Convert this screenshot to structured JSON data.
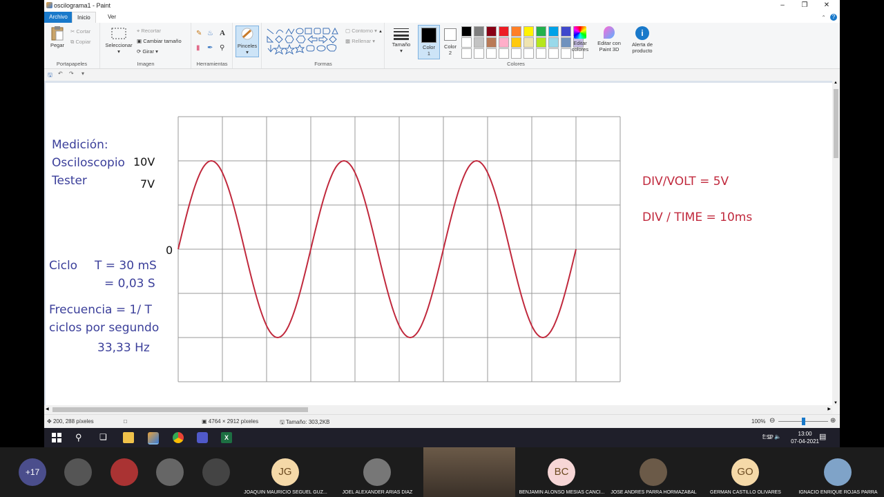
{
  "window": {
    "title": "oscilograma1 - Paint"
  },
  "tabs": {
    "file": "Archivo",
    "home": "Inicio",
    "view": "Ver"
  },
  "ribbon": {
    "clipboard": {
      "paste": "Pegar",
      "cut": "Cortar",
      "copy": "Copiar",
      "label": "Portapapeles"
    },
    "image": {
      "select": "Seleccionar",
      "crop": "Recortar",
      "resize": "Cambiar tamaño",
      "rotate": "Girar",
      "label": "Imagen"
    },
    "tools": {
      "label": "Herramientas"
    },
    "brushes": {
      "label": "Pinceles"
    },
    "shapes": {
      "outline": "Contorno",
      "fill": "Rellenar",
      "label": "Formas"
    },
    "size": {
      "label": "Tamaño"
    },
    "color1": "Color\n1",
    "color2": "Color\n2",
    "colors": {
      "label": "Colores",
      "edit": "Editar colores"
    },
    "paint3d": "Editar con Paint 3D",
    "alert": "Alerta de producto",
    "palette_row1": [
      "#000000",
      "#7f7f7f",
      "#880015",
      "#ed1c24",
      "#ff7f27",
      "#fff200",
      "#22b14c",
      "#00a2e8",
      "#3f48cc",
      "#a349a4"
    ],
    "palette_row2": [
      "#ffffff",
      "#c3c3c3",
      "#b97a57",
      "#ffaec9",
      "#ffc90e",
      "#efe4b0",
      "#b5e61d",
      "#99d9ea",
      "#7092be",
      "#c8bfe7"
    ]
  },
  "canvas": {
    "annotations": {
      "medicion": "Medición:",
      "osciloscopio": "Osciloscopio",
      "tester": "Tester",
      "v10": "10V",
      "v7": "7V",
      "zero": "0",
      "ciclo": "Ciclo",
      "t_eq": "T = 30 mS",
      "t_s": "= 0,03 S",
      "freq": "Frecuencia = 1/ T",
      "ciclos": "ciclos por segundo",
      "hz": "33,33 Hz",
      "divvolt": "DIV/VOLT = 5V",
      "divtime": "DIV / TIME = 10ms"
    },
    "wave_color": "#c0283c"
  },
  "status": {
    "cursor": "200, 288 píxeles",
    "dims": "4764 × 2912 píxeles",
    "filesize": "Tamaño: 303,2KB",
    "zoom": "100%"
  },
  "taskbar": {
    "lang": "ESP",
    "time": "13:00",
    "date": "07-04-2021"
  },
  "meeting": {
    "more": "+17",
    "participants": [
      {
        "initials": "JG",
        "name": "JOAQUIN MAURICIO SEGUEL GUZ...",
        "color": "#f5d9a8"
      },
      {
        "initials": "",
        "name": "JOEL ALEXANDER ARIAS DIAZ",
        "color": "#777777"
      },
      {
        "initials": "BC",
        "name": "BENJAMIN ALONSO MESIAS CANCI...",
        "color": "#f6d6d6"
      },
      {
        "initials": "",
        "name": "JOSE ANDRES PARRA HORMAZABAL",
        "color": "#6b5a48"
      },
      {
        "initials": "GO",
        "name": "GERMAN CASTILLO OLIVARES",
        "color": "#f5d9a8"
      },
      {
        "initials": "",
        "name": "IGNACIO ENRIQUE ROJAS PARRA",
        "color": "#7fa3c8"
      }
    ]
  }
}
